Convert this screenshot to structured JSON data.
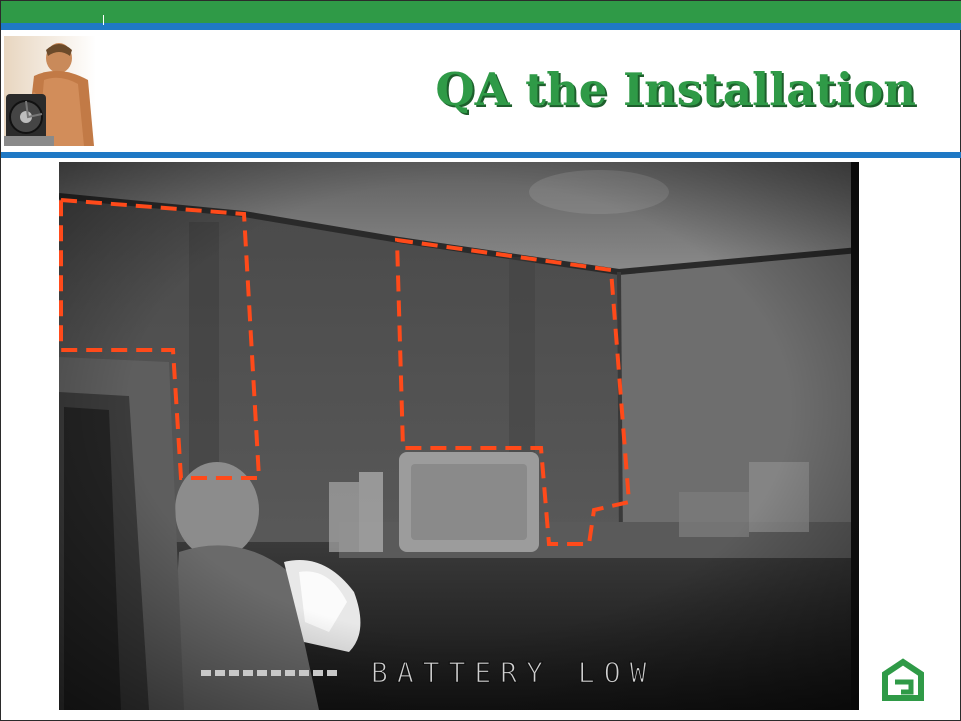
{
  "slide": {
    "title": "QA the Installation"
  },
  "thermal_image": {
    "overlay_text": "BATTERY LOW",
    "outline_color": "#ff4a1a",
    "outlined_regions": 2
  },
  "colors": {
    "brand_green": "#2f9a47",
    "brand_blue": "#1f79c5"
  },
  "icons": {
    "logo": "home-icon"
  }
}
